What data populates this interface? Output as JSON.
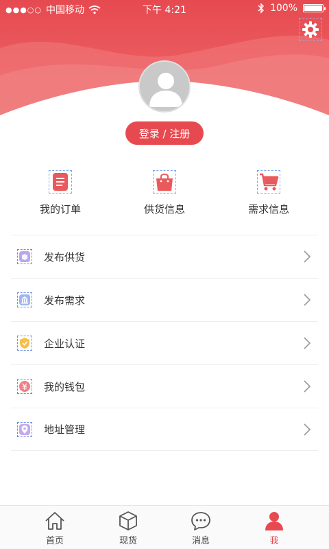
{
  "status_bar": {
    "signal": "●●●○○",
    "carrier": "中国移动",
    "time": "下午 4:21",
    "battery": "100%",
    "battery_level": 1.0
  },
  "header": {
    "accent_color": "#e64a50",
    "settings_icon": "gear-icon",
    "avatar_icon": "user-avatar-icon",
    "login_label": "登录 / 注册"
  },
  "quick_entries": [
    {
      "label": "我的订单",
      "icon": "order-list-icon"
    },
    {
      "label": "供货信息",
      "icon": "shopping-bag-icon"
    },
    {
      "label": "需求信息",
      "icon": "shopping-cart-icon"
    }
  ],
  "menu": [
    {
      "label": "发布供货",
      "icon": "publish-supply-icon"
    },
    {
      "label": "发布需求",
      "icon": "publish-demand-icon"
    },
    {
      "label": "企业认证",
      "icon": "certification-badge-icon"
    },
    {
      "label": "我的钱包",
      "icon": "wallet-icon"
    },
    {
      "label": "地址管理",
      "icon": "location-pin-icon"
    }
  ],
  "tabs": [
    {
      "label": "首页",
      "icon": "home-icon"
    },
    {
      "label": "现货",
      "icon": "box-icon"
    },
    {
      "label": "消息",
      "icon": "message-bubble-icon"
    },
    {
      "label": "我",
      "icon": "profile-icon",
      "active": true
    }
  ]
}
